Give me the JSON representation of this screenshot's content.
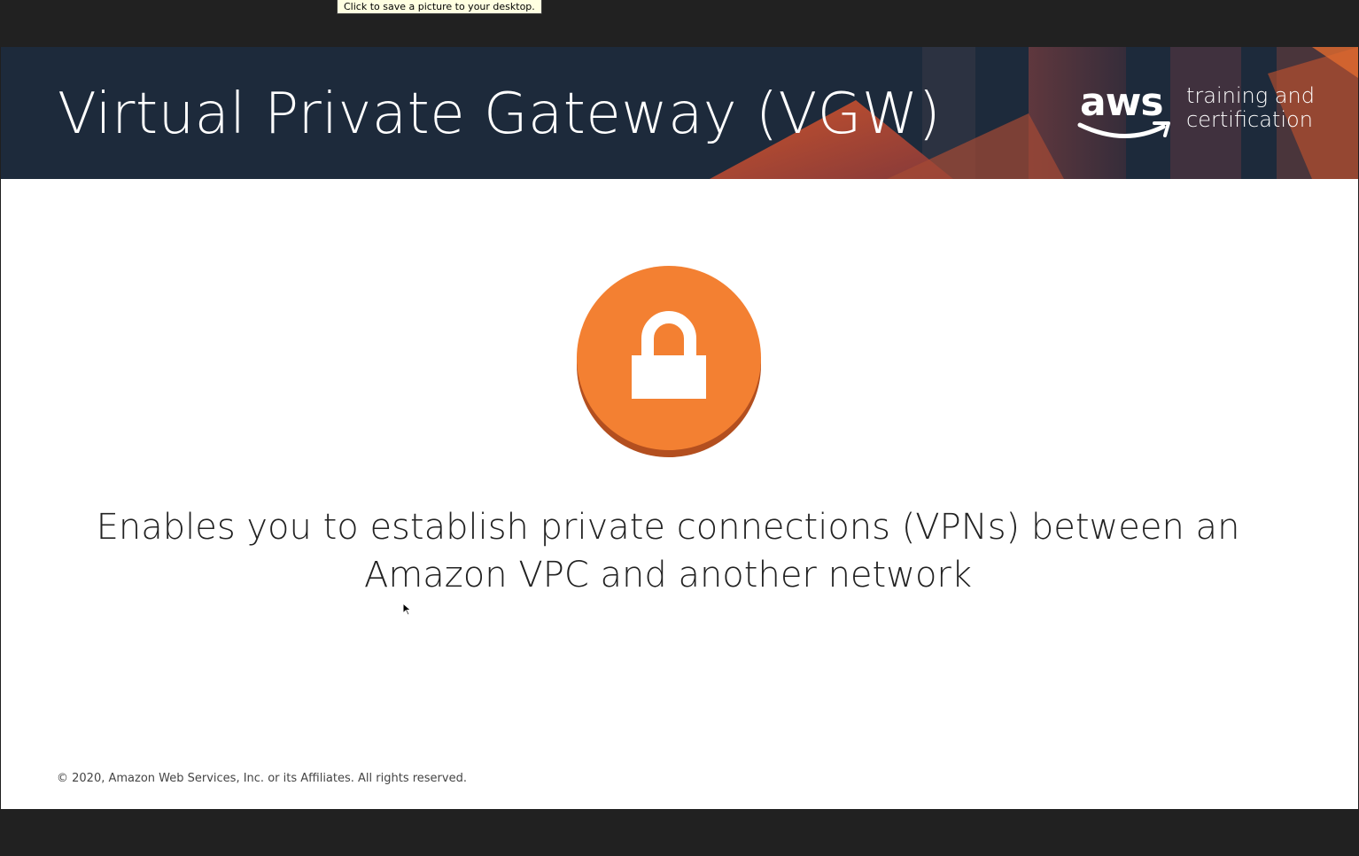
{
  "tooltip": {
    "text": "Click to save a picture to your desktop."
  },
  "slide": {
    "title": "Virtual Private Gateway (VGW)",
    "logo": {
      "wordmark": "aws",
      "tagline_line1": "training and",
      "tagline_line2": "certification"
    },
    "icon": "lock-icon",
    "description": "Enables you to establish private connections (VPNs) between an Amazon VPC and another network",
    "copyright": "© 2020, Amazon Web Services, Inc. or its Affiliates. All rights reserved."
  },
  "colors": {
    "header_background": "#1d2a3b",
    "accent_orange": "#f38032",
    "accent_orange_dark": "#b34f1f",
    "window_frame": "#212121"
  }
}
